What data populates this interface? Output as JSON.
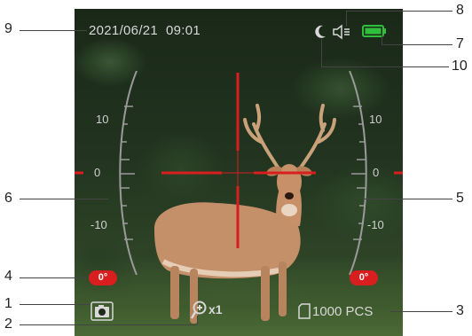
{
  "callouts": [
    "1",
    "2",
    "3",
    "4",
    "5",
    "6",
    "7",
    "8",
    "9",
    "10"
  ],
  "hud": {
    "datetime": "2021/06/21  09:01",
    "zoom": "x1",
    "shots": "1000 PCS",
    "left_scale": {
      "top": "10",
      "mid": "0",
      "bottom": "-10",
      "angle": "0°"
    },
    "right_scale": {
      "top": "10",
      "mid": "0",
      "bottom": "-10",
      "angle": "0°"
    }
  },
  "icons": {
    "moon": "moon-icon",
    "speaker": "speaker-icon",
    "battery": "battery-icon",
    "camera": "camera-icon",
    "zoom": "zoom-icon",
    "storage": "storage-icon"
  },
  "colors": {
    "reticle": "#d81e1e",
    "battery": "#2fbf3a",
    "hud_text": "#d8d8d8"
  }
}
